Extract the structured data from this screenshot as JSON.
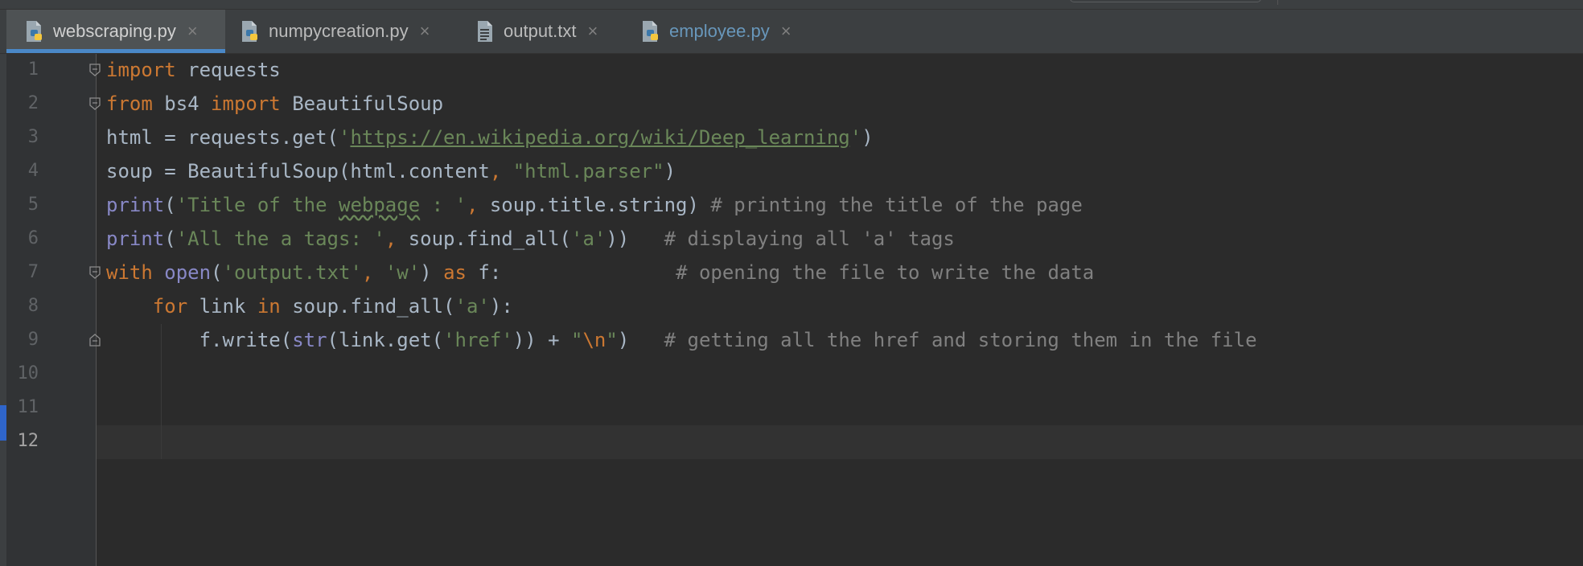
{
  "tabs": [
    {
      "label": "webscraping.py",
      "icon": "python-file-icon",
      "active": true
    },
    {
      "label": "numpycreation.py",
      "icon": "python-file-icon",
      "active": false
    },
    {
      "label": "output.txt",
      "icon": "text-file-icon",
      "active": false
    },
    {
      "label": "employee.py",
      "icon": "python-file-icon",
      "active": false,
      "modified": true
    }
  ],
  "close_glyph": "×",
  "editor": {
    "current_line": 12,
    "line_numbers": [
      "1",
      "2",
      "3",
      "4",
      "5",
      "6",
      "7",
      "8",
      "9",
      "10",
      "11",
      "12"
    ],
    "lines": [
      "import requests",
      "from bs4 import BeautifulSoup",
      "html = requests.get('https://en.wikipedia.org/wiki/Deep_learning')",
      "soup = BeautifulSoup(html.content, \"html.parser\")",
      "print('Title of the webpage : ', soup.title.string) # printing the title of the page",
      "print('All the a tags: ', soup.find_all('a'))   # displaying all 'a' tags",
      "with open('output.txt', 'w') as f:               # opening the file to write the data",
      "    for link in soup.find_all('a'):",
      "        f.write(str(link.get('href')) + \"\\n\")   # getting all the href and storing them in the file",
      "",
      "",
      ""
    ]
  },
  "colors": {
    "keyword": "#cc7832",
    "string": "#6a8759",
    "builtin": "#8888c6",
    "comment": "#808080",
    "text": "#a9b7c6",
    "accent": "#4a88c7"
  }
}
